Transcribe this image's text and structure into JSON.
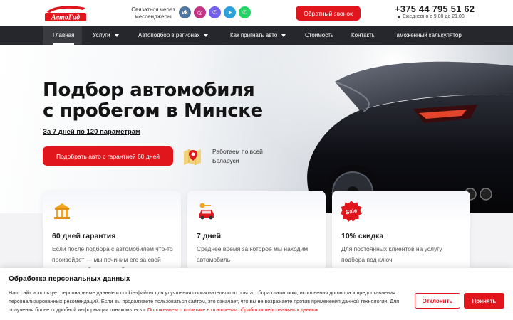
{
  "header": {
    "logo_text": "АвтоГид",
    "messengers_label": "Связаться через мессенджеры",
    "social": [
      {
        "name": "vk",
        "glyph": "vk"
      },
      {
        "name": "instagram",
        "glyph": "◎"
      },
      {
        "name": "viber",
        "glyph": "✆"
      },
      {
        "name": "telegram",
        "glyph": "➤"
      },
      {
        "name": "whatsapp",
        "glyph": "✆"
      }
    ],
    "callback_label": "Обратный звонок",
    "phone": "+375 44 795 51 62",
    "hours": "Ежедневно с 9.00 до 21.00"
  },
  "nav": {
    "items": [
      {
        "label": "Главная"
      },
      {
        "label": "Услуги"
      },
      {
        "label": "Автоподбор в регионах"
      },
      {
        "label": "Как пригнать авто"
      },
      {
        "label": "Стоимость"
      },
      {
        "label": "Контакты"
      },
      {
        "label": "Таможенный калькулятор"
      }
    ]
  },
  "hero": {
    "title_line1": "Подбор автомобиля",
    "title_line2": "с пробегом в Минске",
    "subtitle": "За 7 дней по 120 параметрам",
    "cta_label": "Подобрать авто с гарантией 60 дней",
    "region_text": "Работаем по всей Беларуси"
  },
  "cards": [
    {
      "title": "60 дней гарантия",
      "text": "Если после подбора с автомобилем что-то произойдет — мы починим его за свой счет или подберем новый"
    },
    {
      "title": "7 дней",
      "text": "Среднее время за которое мы находим автомобиль"
    },
    {
      "title": "10% скидка",
      "text": "Для постоянных клиентов на услугу подбора под ключ",
      "badge": "Sale"
    }
  ],
  "cookie": {
    "title": "Обработка персональных данных",
    "text": "Наш сайт использует персональные данные и cookie-файлы для улучшения пользовательского опыта, сбора статистики, исполнения договора и предоставления персонализированных рекомендаций. Если вы продолжаете пользоваться сайтом, это означает, что вы не возражаете против применения данной технологии. Для получения более подробной информации ознакомьтесь с ",
    "link": "Положением о политике в отношении обработки персональных данных.",
    "decline_label": "Отклонить",
    "accept_label": "Принять"
  },
  "colors": {
    "accent": "#e0161c",
    "nav_bg": "#26272c"
  }
}
